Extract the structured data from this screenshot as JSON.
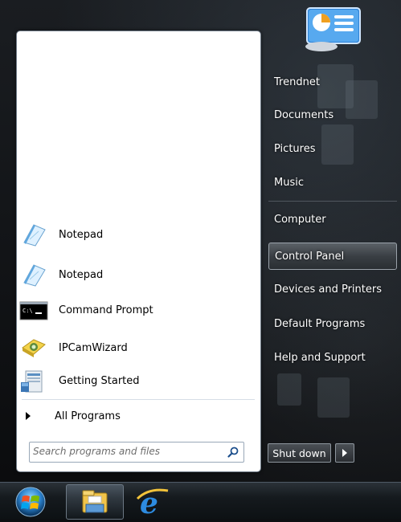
{
  "left_pane": {
    "programs": [
      {
        "label": "Notepad",
        "icon": "notepad-icon"
      },
      {
        "label": "Notepad",
        "icon": "notepad-icon"
      },
      {
        "label": "Command Prompt",
        "icon": "command-prompt-icon"
      },
      {
        "label": "IPCamWizard",
        "icon": "ipcamwizard-icon"
      },
      {
        "label": "Getting Started",
        "icon": "getting-started-icon"
      }
    ],
    "all_programs": "All Programs",
    "search_placeholder": "Search programs and files"
  },
  "right_pane": {
    "items": [
      {
        "label": "Trendnet"
      },
      {
        "label": "Documents"
      },
      {
        "label": "Pictures"
      },
      {
        "label": "Music"
      },
      {
        "label": "Computer"
      },
      {
        "label": "Control Panel",
        "highlighted": true
      },
      {
        "label": "Devices and Printers"
      },
      {
        "label": "Default Programs"
      },
      {
        "label": "Help and Support"
      }
    ],
    "shutdown_label": "Shut down"
  },
  "taskbar": {
    "items": [
      {
        "icon": "start-orb-icon"
      },
      {
        "icon": "windows-explorer-icon"
      },
      {
        "icon": "internet-explorer-icon"
      }
    ]
  },
  "colors": {
    "highlight": "#4a5056",
    "panel_border": "#6f7b88"
  }
}
